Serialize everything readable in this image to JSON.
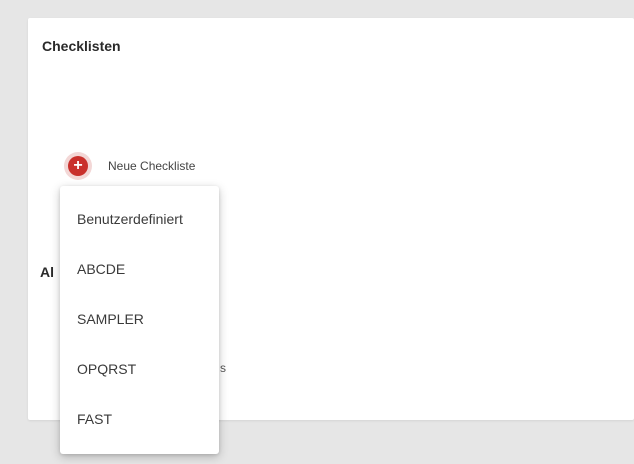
{
  "card": {
    "title": "Checklisten",
    "new_button_label": "Neue Checkliste",
    "add_icon": "plus-circle-icon",
    "accent_color": "#c9302c",
    "partially_hidden_heading": "Al",
    "partially_hidden_text": "s"
  },
  "dropdown": {
    "items": [
      "Benutzerdefiniert",
      "ABCDE",
      "SAMPLER",
      "OPQRST",
      "FAST"
    ]
  }
}
